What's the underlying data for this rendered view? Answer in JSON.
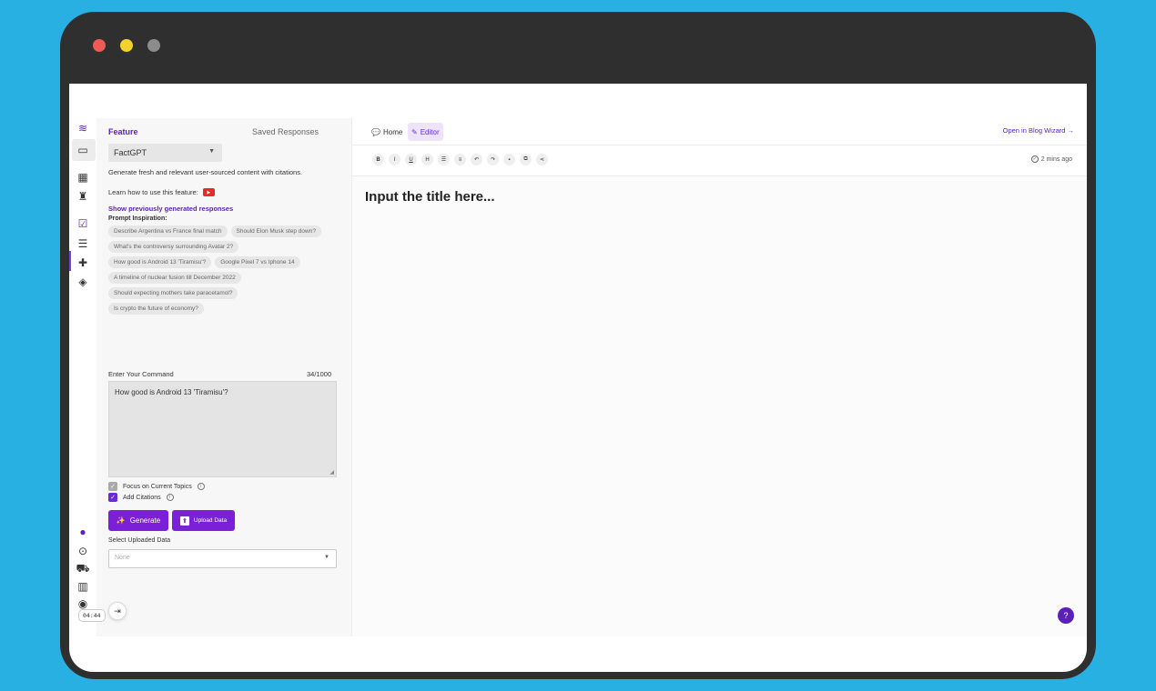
{
  "sidebar": {
    "tabs": {
      "feature": "Feature",
      "saved": "Saved Responses"
    },
    "feature_select": "FactGPT",
    "description": "Generate fresh and relevant user-sourced content with citations.",
    "learn_label": "Learn how to use this feature:",
    "show_previous": "Show previously generated responses",
    "prompt_title": "Prompt Inspiration:",
    "chips": [
      "Describe Argentina vs France final match",
      "Should Elon Musk step down?",
      "What's the controversy surrounding Avatar 2?",
      "How good is Android 13 'Tiramisu'?",
      "Google Pixel 7 vs Iphone 14",
      "A timeline of nuclear fusion till December 2022",
      "Should expecting mothers take paracetamol?",
      "Is crypto the future of economy?"
    ],
    "command_label": "Enter Your Command",
    "command_count": "34/1000",
    "command_value": "How good is Android 13 'Tiramisu'?",
    "focus_label": "Focus on Current Topics",
    "citations_label": "Add Citations",
    "generate_label": "Generate",
    "upload_label": "Upload Data",
    "select_uploaded_label": "Select Uploaded Data",
    "select_uploaded_value": "None",
    "timer": "04:44"
  },
  "editor": {
    "tabs": {
      "home": "Home",
      "editor": "Editor"
    },
    "open_wizard": "Open in Blog Wizard →",
    "saved_time": "2 mins ago",
    "title_placeholder": "Input the title here..."
  },
  "colors": {
    "accent": "#7c1fd9",
    "background": "#29b0e3",
    "frame": "#2f2f2f"
  }
}
